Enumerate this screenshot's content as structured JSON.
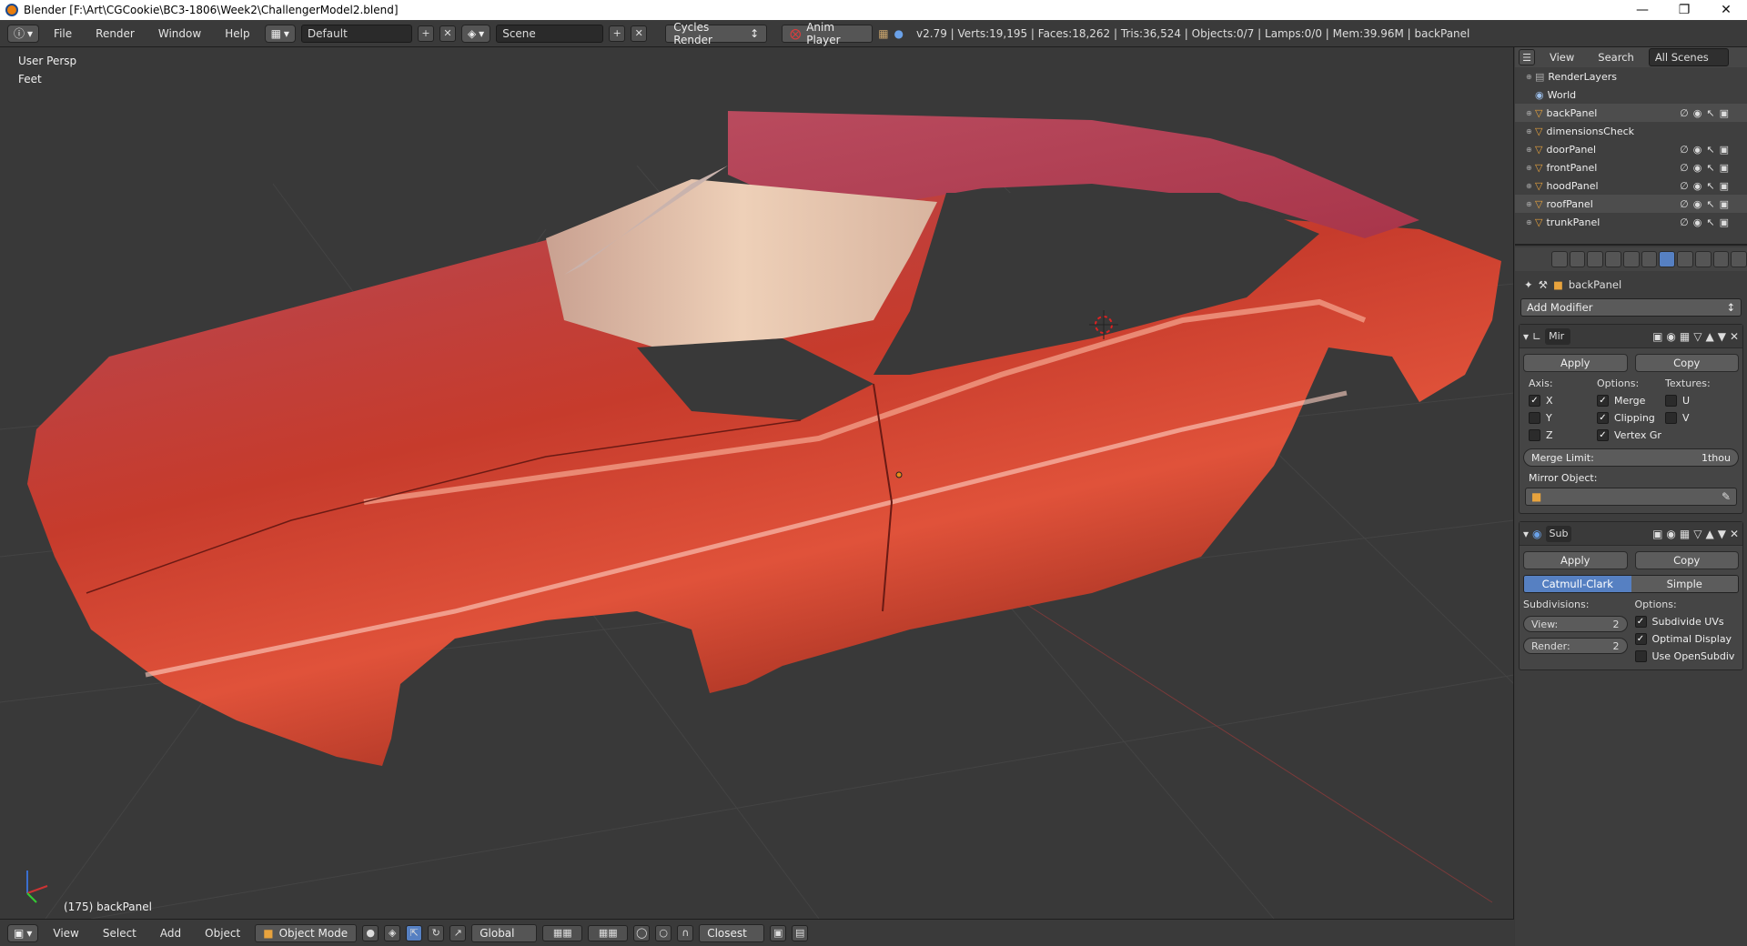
{
  "title": {
    "text": "Blender [F:\\Art\\CGCookie\\BC3-1806\\Week2\\ChallengerModel2.blend]"
  },
  "menu": [
    "File",
    "Render",
    "Window",
    "Help"
  ],
  "layout_field": "Default",
  "scene_field": "Scene",
  "engine": "Cycles Render",
  "anim_player": "Anim Player",
  "stats": "v2.79 | Verts:19,195 | Faces:18,262 | Tris:36,524 | Objects:0/7 | Lamps:0/0 | Mem:39.96M | backPanel",
  "viewport": {
    "persp": "User Persp",
    "units": "Feet",
    "active_label": "(175) backPanel"
  },
  "bottom": {
    "menus": [
      "View",
      "Select",
      "Add",
      "Object"
    ],
    "mode": "Object Mode",
    "orientation": "Global",
    "snap": "Closest"
  },
  "outliner": {
    "header": {
      "view": "View",
      "search": "Search",
      "scenes": "All Scenes"
    },
    "rows": [
      "RenderLayers",
      "World",
      "backPanel",
      "dimensionsCheck",
      "doorPanel",
      "frontPanel",
      "hoodPanel",
      "roofPanel",
      "trunkPanel"
    ]
  },
  "props": {
    "context": "backPanel",
    "add_modifier": "Add Modifier",
    "mirror": {
      "name": "Mir",
      "apply": "Apply",
      "copy": "Copy",
      "axis_label": "Axis:",
      "options_label": "Options:",
      "textures_label": "Textures:",
      "x": "X",
      "y": "Y",
      "z": "Z",
      "merge": "Merge",
      "clipping": "Clipping",
      "vertex": "Vertex Gr",
      "u": "U",
      "v": "V",
      "merge_limit_label": "Merge Limit:",
      "merge_limit_value": "1thou",
      "mirror_object": "Mirror Object:"
    },
    "subsurf": {
      "name": "Sub",
      "apply": "Apply",
      "copy": "Copy",
      "catmull": "Catmull-Clark",
      "simple": "Simple",
      "subdiv_label": "Subdivisions:",
      "options_label": "Options:",
      "view_label": "View:",
      "view_value": "2",
      "render_label": "Render:",
      "render_value": "2",
      "uvs": "Subdivide UVs",
      "optimal": "Optimal Display",
      "opensubdiv": "Use OpenSubdiv"
    }
  },
  "colors": {
    "car": "#c8352a",
    "accent": "#5680c2",
    "bg": "#393939"
  }
}
